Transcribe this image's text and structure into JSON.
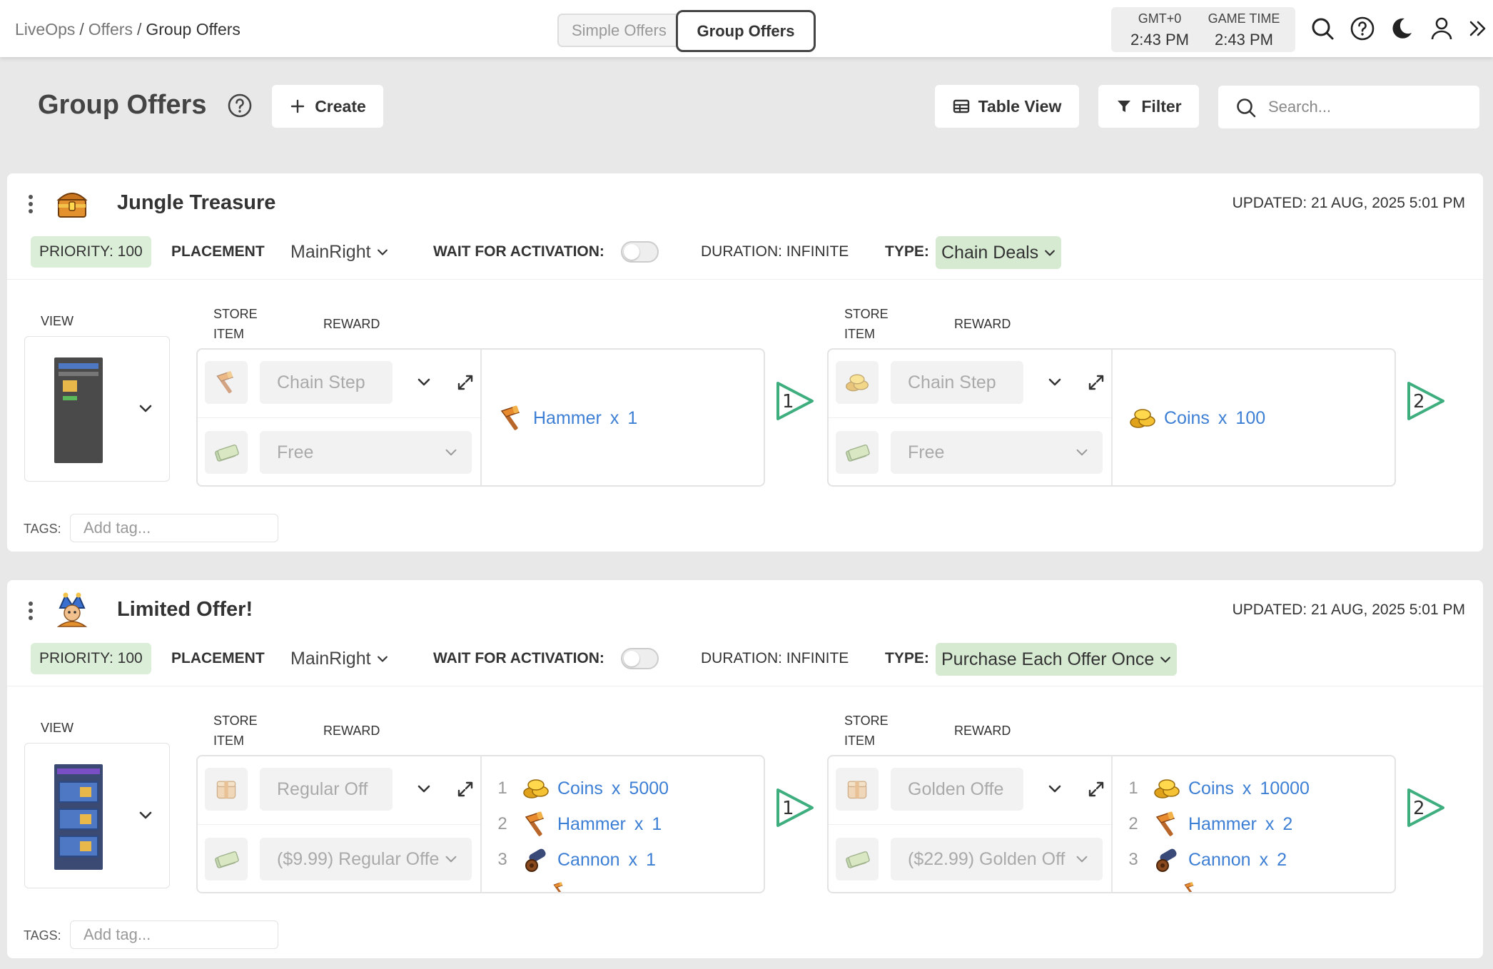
{
  "breadcrumb": [
    "LiveOps",
    "Offers",
    "Group Offers"
  ],
  "mode_tabs": {
    "simple": "Simple Offers",
    "group": "Group Offers"
  },
  "clock": {
    "tz_label": "GMT+0",
    "tz_time": "2:43 PM",
    "game_label": "GAME TIME",
    "game_time": "2:43 PM"
  },
  "top_icons": [
    "search-icon",
    "help-icon",
    "moon-icon",
    "user-icon",
    "double-chevron-right-icon"
  ],
  "page": {
    "title": "Group Offers",
    "create_label": "Create",
    "table_view_label": "Table View",
    "filter_label": "Filter",
    "search_placeholder": "Search..."
  },
  "labels": {
    "placement": "PLACEMENT",
    "wait_for_activation": "WAIT FOR ACTIVATION:",
    "type": "TYPE:",
    "view": "VIEW",
    "store_item_1": "STORE",
    "store_item_2": "ITEM",
    "reward": "REWARD",
    "tags": "TAGS:",
    "tags_placeholder": "Add tag..."
  },
  "offers": [
    {
      "title": "Jungle Treasure",
      "icon": "treasure-chest-icon",
      "updated": "UPDATED: 21 AUG, 2025 5:01 PM",
      "priority": "PRIORITY: 100",
      "placement": "MainRight",
      "wait_for_activation": false,
      "duration": "DURATION: INFINITE",
      "type": "Chain Deals",
      "steps": [
        {
          "step": "1",
          "store_item": "Chain Step",
          "price": "Free",
          "item_icon": "hammer-icon",
          "rewards": [
            {
              "index": "",
              "name": "Hammer",
              "x": "x",
              "qty": "1",
              "icon": "hammer-icon"
            }
          ]
        },
        {
          "step": "2",
          "store_item": "Chain Step",
          "price": "Free",
          "item_icon": "coins-icon",
          "rewards": [
            {
              "index": "",
              "name": "Coins",
              "x": "x",
              "qty": "100",
              "icon": "coins-icon"
            }
          ]
        }
      ]
    },
    {
      "title": "Limited Offer!",
      "icon": "jester-icon",
      "updated": "UPDATED: 21 AUG, 2025 5:01 PM",
      "priority": "PRIORITY: 100",
      "placement": "MainRight",
      "wait_for_activation": false,
      "duration": "DURATION: INFINITE",
      "type": "Purchase Each Offer Once",
      "steps": [
        {
          "step": "1",
          "store_item": "Regular Off",
          "price": "($9.99) Regular Offe",
          "item_icon": "bundle-icon",
          "rewards": [
            {
              "index": "1",
              "name": "Coins",
              "x": "x",
              "qty": "5000",
              "icon": "coins-icon"
            },
            {
              "index": "2",
              "name": "Hammer",
              "x": "x",
              "qty": "1",
              "icon": "hammer-icon"
            },
            {
              "index": "3",
              "name": "Cannon",
              "x": "x",
              "qty": "1",
              "icon": "cannon-icon"
            }
          ]
        },
        {
          "step": "2",
          "store_item": "Golden Offe",
          "price": "($22.99) Golden Off",
          "item_icon": "bundle-icon",
          "rewards": [
            {
              "index": "1",
              "name": "Coins",
              "x": "x",
              "qty": "10000",
              "icon": "coins-icon"
            },
            {
              "index": "2",
              "name": "Hammer",
              "x": "x",
              "qty": "2",
              "icon": "hammer-icon"
            },
            {
              "index": "3",
              "name": "Cannon",
              "x": "x",
              "qty": "2",
              "icon": "cannon-icon"
            }
          ]
        }
      ]
    }
  ],
  "colors": {
    "accent_green": "#3fae7f",
    "pill_green": "#dbeed8",
    "link_blue": "#3d7fd4"
  }
}
